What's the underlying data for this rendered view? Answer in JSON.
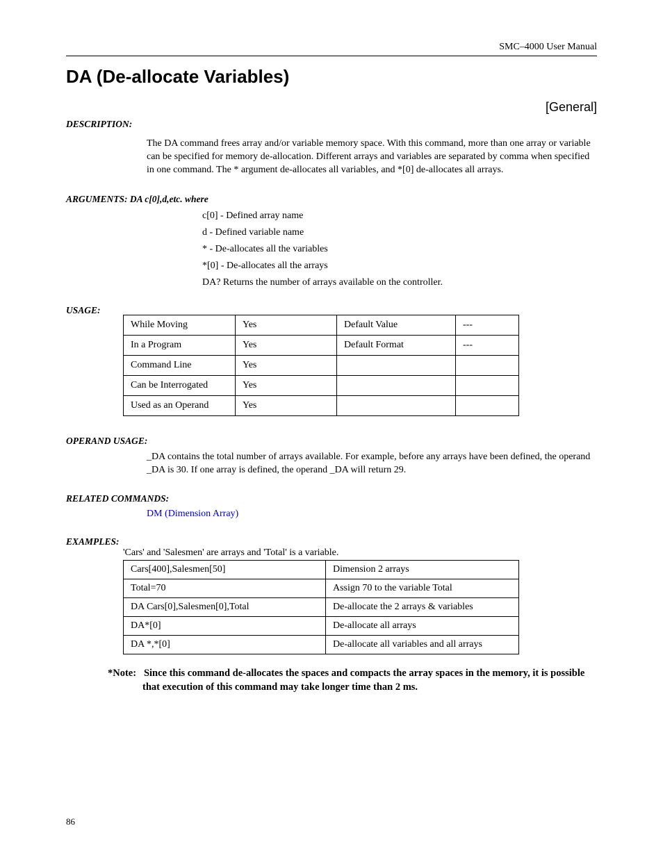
{
  "header": {
    "manual": "SMC–4000 User Manual"
  },
  "title": "DA (De-allocate Variables)",
  "category": "[General]",
  "description": {
    "label": "DESCRIPTION:",
    "text": "The DA command frees array and/or variable memory space. With this command, more than one array or variable can be specified for memory de-allocation. Different arrays and variables are separated by comma when specified in one command. The * argument de-allocates all variables, and *[0] de-allocates all arrays."
  },
  "arguments": {
    "label": "ARGUMENTS:  DA c[0],d,etc.            where",
    "items": [
      "c[0] - Defined array name",
      "d - Defined variable name",
      "* - De-allocates all the variables",
      "*[0] - De-allocates all the arrays",
      "DA? Returns the number of arrays available on the controller."
    ]
  },
  "usage": {
    "label": "USAGE:",
    "rows": [
      [
        "While Moving",
        "Yes",
        "Default Value",
        "---"
      ],
      [
        "In a Program",
        "Yes",
        "Default Format",
        "---"
      ],
      [
        "Command Line",
        "Yes",
        "",
        ""
      ],
      [
        "Can be Interrogated",
        "Yes",
        "",
        ""
      ],
      [
        "Used as an Operand",
        "Yes",
        "",
        ""
      ]
    ]
  },
  "operand_usage": {
    "label": "OPERAND USAGE:",
    "text": "_DA contains the total number of arrays available.  For example, before any arrays have been defined, the operand _DA is 30.  If one array is defined, the operand _DA will return 29."
  },
  "related": {
    "label": "RELATED COMMANDS:",
    "link": "DM (Dimension Array)"
  },
  "examples": {
    "label": "EXAMPLES:",
    "caption": "'Cars' and 'Salesmen' are arrays and 'Total' is a variable.",
    "rows": [
      [
        "Cars[400],Salesmen[50]",
        "Dimension 2 arrays"
      ],
      [
        "Total=70",
        "Assign 70 to the variable Total"
      ],
      [
        "DA Cars[0],Salesmen[0],Total",
        "De-allocate the 2 arrays & variables"
      ],
      [
        "DA*[0]",
        "De-allocate all arrays"
      ],
      [
        "DA *,*[0]",
        "De-allocate all variables and all arrays"
      ]
    ]
  },
  "note": {
    "prefix": "*Note:",
    "text": "Since this command de-allocates the spaces and compacts the array spaces in the memory, it is possible that execution of this command may take longer time than 2 ms."
  },
  "page": "86"
}
